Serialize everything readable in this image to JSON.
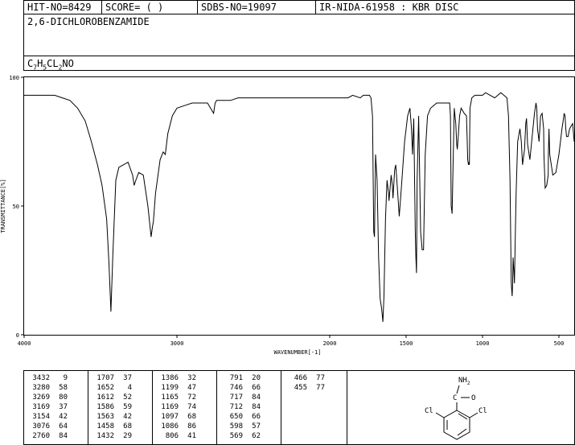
{
  "header": {
    "hit_no": "HIT-NO=8429",
    "score": "SCORE=  (   )",
    "sdbs_no": "SDBS-NO=19097",
    "ir_nida": "IR-NIDA-61958 : KBR DISC",
    "compound_name": "2,6-DICHLOROBENZAMIDE",
    "formula_parts": [
      "C",
      "7",
      "H",
      "5",
      "CL",
      "2",
      "NO"
    ]
  },
  "chart_data": {
    "type": "line",
    "xlabel": "WAVENUMBER[-1]",
    "ylabel": "TRANSMITTANCE[%]",
    "xlim": [
      4000,
      400
    ],
    "ylim": [
      0,
      100
    ],
    "x_ticks": [
      4000,
      3000,
      2000,
      1500,
      1000,
      500
    ],
    "y_ticks": [
      0,
      50,
      100
    ],
    "grid": false,
    "x": [
      4000,
      3900,
      3800,
      3750,
      3700,
      3650,
      3600,
      3560,
      3520,
      3490,
      3460,
      3445,
      3432,
      3420,
      3400,
      3380,
      3350,
      3320,
      3290,
      3280,
      3269,
      3250,
      3220,
      3190,
      3169,
      3160,
      3154,
      3140,
      3110,
      3090,
      3076,
      3060,
      3030,
      3000,
      2950,
      2900,
      2850,
      2800,
      2760,
      2750,
      2740,
      2700,
      2650,
      2600,
      2500,
      2400,
      2300,
      2200,
      2100,
      2000,
      1950,
      1900,
      1880,
      1850,
      1800,
      1780,
      1760,
      1750,
      1740,
      1730,
      1720,
      1712,
      1707,
      1700,
      1690,
      1680,
      1670,
      1660,
      1652,
      1645,
      1635,
      1625,
      1615,
      1612,
      1605,
      1598,
      1590,
      1586,
      1575,
      1568,
      1563,
      1555,
      1545,
      1530,
      1510,
      1490,
      1475,
      1465,
      1458,
      1450,
      1440,
      1436,
      1432,
      1428,
      1418,
      1405,
      1395,
      1386,
      1375,
      1360,
      1340,
      1320,
      1300,
      1270,
      1250,
      1230,
      1215,
      1210,
      1205,
      1199,
      1193,
      1185,
      1175,
      1169,
      1165,
      1160,
      1150,
      1140,
      1120,
      1105,
      1100,
      1097,
      1092,
      1088,
      1086,
      1082,
      1070,
      1050,
      1000,
      980,
      950,
      920,
      900,
      880,
      860,
      840,
      830,
      820,
      812,
      806,
      803,
      800,
      795,
      791,
      785,
      780,
      770,
      755,
      746,
      738,
      725,
      717,
      712,
      705,
      690,
      670,
      660,
      650,
      645,
      640,
      630,
      620,
      610,
      600,
      598,
      595,
      590,
      580,
      570,
      569,
      565,
      560,
      540,
      520,
      500,
      480,
      470,
      466,
      460,
      455,
      450,
      440,
      430,
      420,
      410,
      400
    ],
    "y": [
      93,
      93,
      93,
      92,
      91,
      88,
      83,
      75,
      66,
      58,
      45,
      28,
      9,
      30,
      60,
      65,
      66,
      67,
      62,
      58,
      60,
      63,
      62,
      50,
      38,
      42,
      44,
      55,
      68,
      71,
      70,
      78,
      85,
      88,
      89,
      90,
      90,
      90,
      86,
      90,
      91,
      91,
      91,
      92,
      92,
      92,
      92,
      92,
      92,
      92,
      92,
      92,
      92,
      93,
      92,
      93,
      93,
      93,
      93,
      92,
      85,
      40,
      38,
      70,
      60,
      30,
      14,
      10,
      5,
      15,
      45,
      60,
      55,
      52,
      57,
      62,
      58,
      53,
      64,
      66,
      62,
      55,
      46,
      58,
      75,
      85,
      88,
      80,
      70,
      84,
      40,
      30,
      24,
      60,
      85,
      40,
      33,
      33,
      70,
      85,
      88,
      89,
      90,
      90,
      90,
      90,
      90,
      85,
      50,
      47,
      65,
      88,
      82,
      74,
      72,
      76,
      85,
      88,
      86,
      85,
      75,
      68,
      66,
      67,
      66,
      88,
      92,
      93,
      93,
      94,
      93,
      92,
      93,
      94,
      93,
      92,
      85,
      60,
      20,
      15,
      20,
      30,
      25,
      20,
      40,
      55,
      75,
      80,
      75,
      66,
      72,
      82,
      84,
      74,
      68,
      80,
      86,
      90,
      88,
      80,
      75,
      85,
      86,
      80,
      70,
      65,
      57,
      58,
      62,
      70,
      80,
      70,
      62,
      63,
      70,
      80,
      84,
      86,
      85,
      80,
      77,
      77,
      80,
      81,
      82,
      75,
      70
    ]
  },
  "peak_table": {
    "columns": [
      [
        [
          "3432",
          "9"
        ],
        [
          "3280",
          "58"
        ],
        [
          "3269",
          "80"
        ],
        [
          "3169",
          "37"
        ],
        [
          "3154",
          "42"
        ],
        [
          "3076",
          "64"
        ],
        [
          "2760",
          "84"
        ]
      ],
      [
        [
          "1707",
          "37"
        ],
        [
          "1652",
          "4"
        ],
        [
          "1612",
          "52"
        ],
        [
          "1586",
          "59"
        ],
        [
          "1563",
          "42"
        ],
        [
          "1458",
          "68"
        ],
        [
          "1432",
          "29"
        ]
      ],
      [
        [
          "1386",
          "32"
        ],
        [
          "1199",
          "47"
        ],
        [
          "1165",
          "72"
        ],
        [
          "1169",
          "74"
        ],
        [
          "1097",
          "68"
        ],
        [
          "1086",
          "86"
        ],
        [
          "806",
          "41"
        ]
      ],
      [
        [
          "791",
          "20"
        ],
        [
          "746",
          "66"
        ],
        [
          "717",
          "84"
        ],
        [
          "712",
          "84"
        ],
        [
          "650",
          "66"
        ],
        [
          "598",
          "57"
        ],
        [
          "569",
          "62"
        ]
      ],
      [
        [
          "466",
          "77"
        ],
        [
          "455",
          "77"
        ]
      ]
    ]
  },
  "structure": {
    "group_top": "NH",
    "group_top_sub": "2",
    "carbonyl_o": "O",
    "carbon": "C",
    "left_sub": "Cl",
    "right_sub": "Cl"
  }
}
